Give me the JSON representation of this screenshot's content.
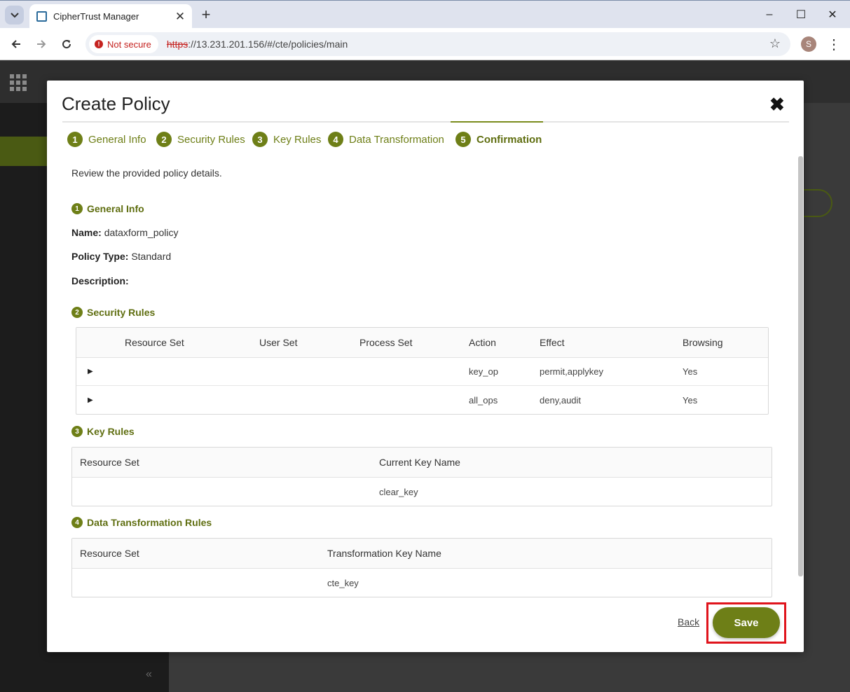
{
  "browser": {
    "tab_title": "CipherTrust Manager",
    "security_label": "Not secure",
    "url_protocol": "https",
    "url_rest": "://13.231.201.156/#/cte/policies/main",
    "profile_initial": "S",
    "minimize": "–",
    "maximize": "☐",
    "close": "✕",
    "new_tab": "+",
    "tab_close": "✕"
  },
  "modal": {
    "title": "Create Policy",
    "close": "✖",
    "steps": [
      {
        "num": "1",
        "label": "General Info"
      },
      {
        "num": "2",
        "label": "Security Rules"
      },
      {
        "num": "3",
        "label": "Key Rules"
      },
      {
        "num": "4",
        "label": "Data Transformation"
      },
      {
        "num": "5",
        "label": "Confirmation"
      }
    ],
    "intro": "Review the provided policy details.",
    "general": {
      "num": "1",
      "title": "General Info",
      "name_label": "Name:",
      "name_value": "dataxform_policy",
      "type_label": "Policy Type:",
      "type_value": "Standard",
      "desc_label": "Description:"
    },
    "security_rules": {
      "num": "2",
      "title": "Security Rules",
      "columns": [
        "Resource Set",
        "User Set",
        "Process Set",
        "Action",
        "Effect",
        "Browsing"
      ],
      "rows": [
        {
          "action": "key_op",
          "effect": "permit,applykey",
          "browsing": "Yes"
        },
        {
          "action": "all_ops",
          "effect": "deny,audit",
          "browsing": "Yes"
        }
      ]
    },
    "key_rules": {
      "num": "3",
      "title": "Key Rules",
      "columns": [
        "Resource Set",
        "Current Key Name"
      ],
      "rows": [
        {
          "current_key": "clear_key"
        }
      ]
    },
    "dt_rules": {
      "num": "4",
      "title": "Data Transformation Rules",
      "columns": [
        "Resource Set",
        "Transformation Key Name"
      ],
      "rows": [
        {
          "key": "cte_key"
        }
      ]
    },
    "back_label": "Back",
    "save_label": "Save"
  },
  "colors": {
    "accent": "#6e7f17",
    "highlight": "#e0141c"
  }
}
